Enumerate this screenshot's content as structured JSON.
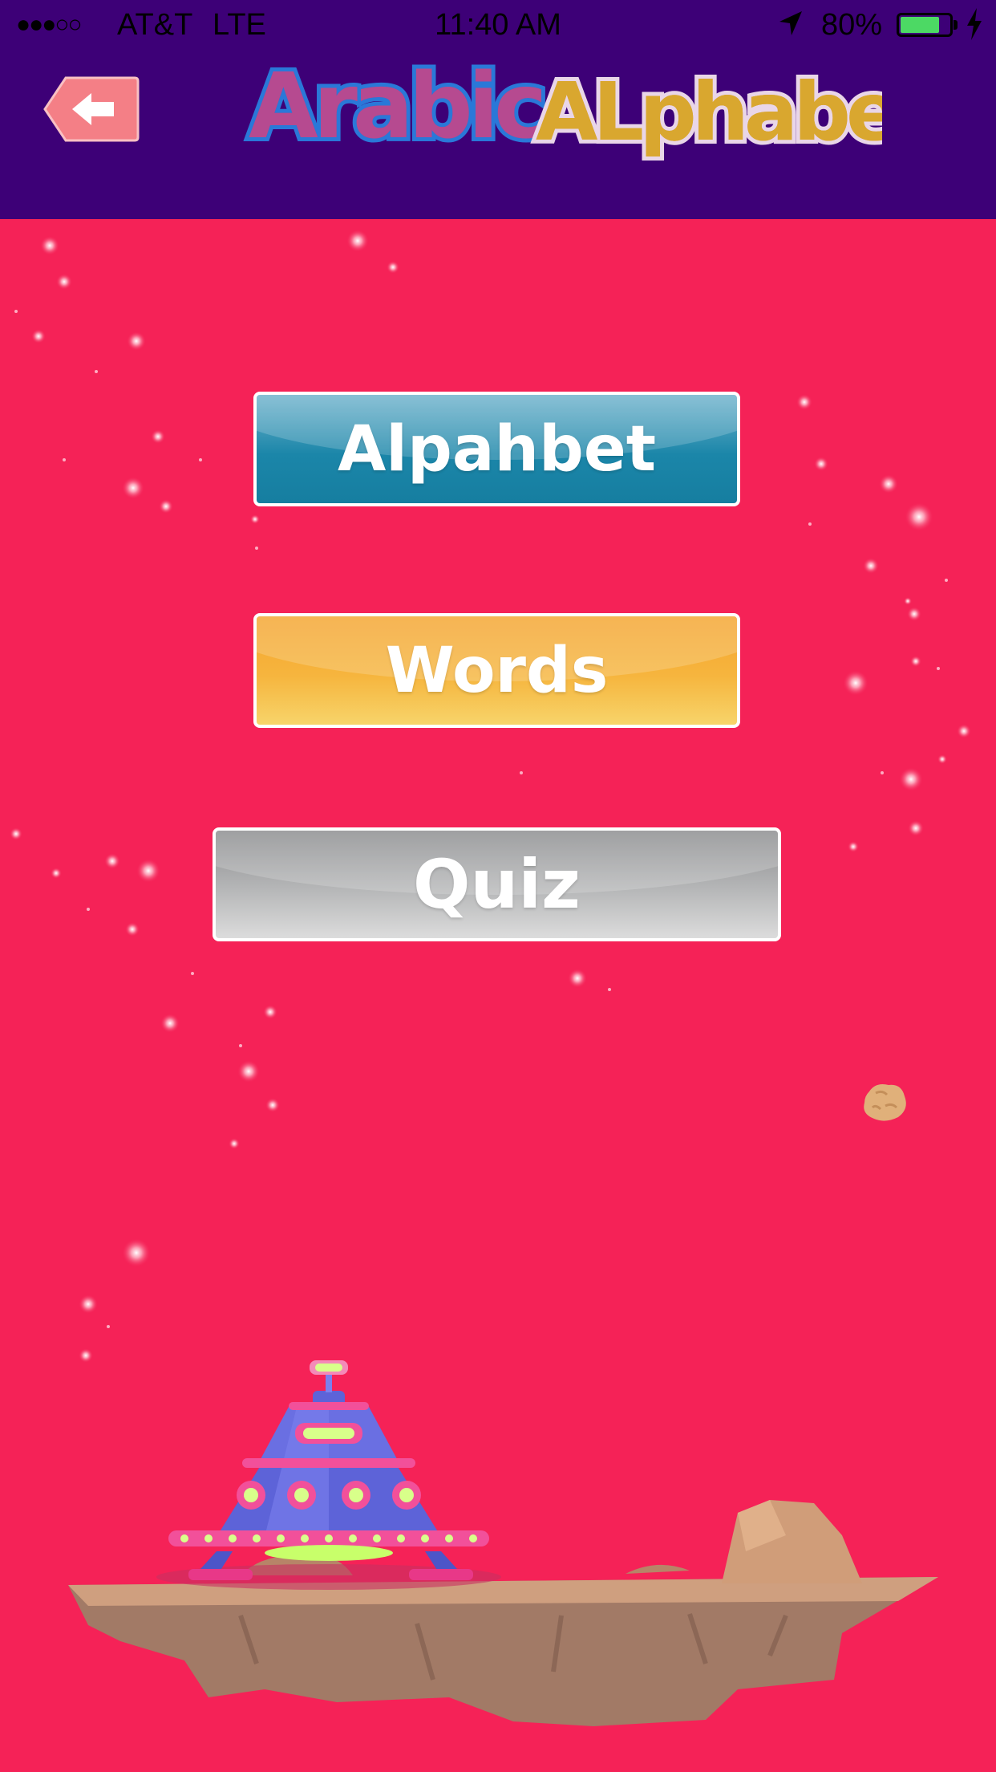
{
  "status_bar": {
    "signal": "●●●○○",
    "carrier": "AT&T",
    "network": "LTE",
    "time": "11:40 AM",
    "battery_percent": "80%",
    "battery_level": 0.8
  },
  "header": {
    "logo_text": "Arabic Alphabet",
    "back_icon": "arrow-left-icon"
  },
  "menu": {
    "alphabet_label": "Alpahbet",
    "words_label": "Words",
    "quiz_label": "Quiz"
  },
  "colors": {
    "header_bg": "#3d0077",
    "page_bg": "#f52257",
    "alphabet_btn": "#1b86a9",
    "words_btn": "#f6b53e",
    "quiz_btn": "#b6b7b8"
  }
}
